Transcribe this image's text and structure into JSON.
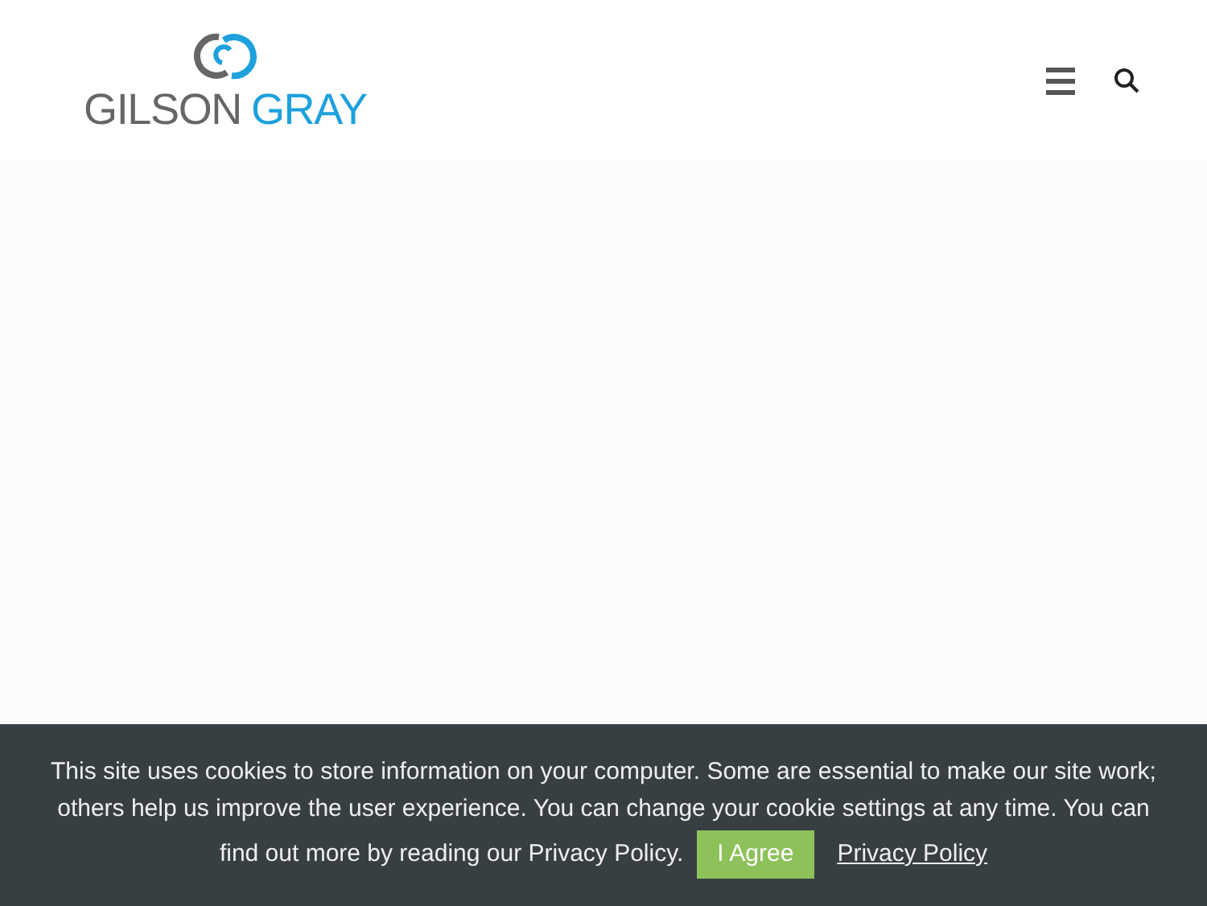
{
  "header": {
    "logo": {
      "words": [
        "GILSON",
        "GRAY"
      ]
    }
  },
  "cookie_banner": {
    "message": [
      "This site uses cookies to store information on your computer. Some are essential to make our site work; others help us improve the user experience. You can change your cookie settings at any time. You can",
      "find out more by reading our Privacy Policy."
    ],
    "agree_button": "I Agree",
    "policy_link": "Privacy Policy"
  }
}
